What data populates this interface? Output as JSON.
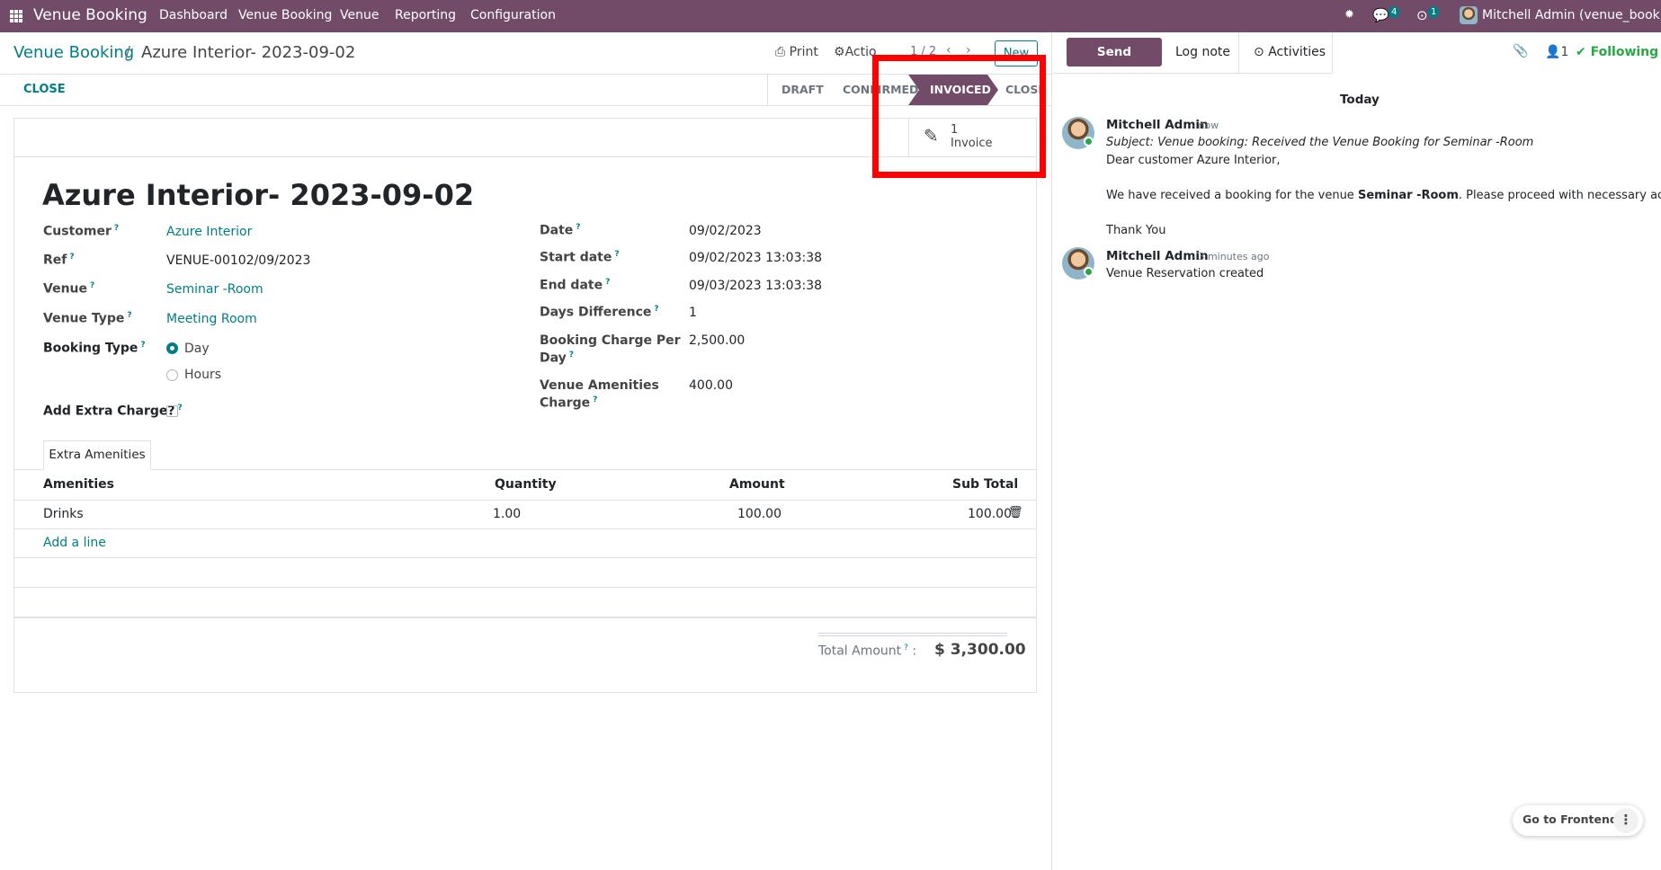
{
  "topbar": {
    "app": "Venue Booking",
    "menu": [
      "Dashboard",
      "Venue Booking",
      "Venue",
      "Reporting",
      "Configuration"
    ],
    "messages": "4",
    "activities": "1",
    "user": "Mitchell Admin (venue_booking)"
  },
  "breadcrumb": {
    "parent": "Venue Booking",
    "sep": "/",
    "current": "Azure Interior- 2023-09-02"
  },
  "cp": {
    "print": "Print",
    "action": "Actio",
    "pager": "1 / 2",
    "new": "New",
    "close": "CLOSE"
  },
  "stages": [
    "DRAFT",
    "CONFIRMED",
    "INVOICED",
    "CLOSE"
  ],
  "smart": {
    "count": "1",
    "label": "Invoice"
  },
  "title": "Azure Interior- 2023-09-02",
  "left": {
    "customer_l": "Customer",
    "customer": "Azure Interior",
    "ref_l": "Ref",
    "ref": "VENUE-00102/09/2023",
    "venue_l": "Venue",
    "venue": "Seminar -Room",
    "type_l": "Venue Type",
    "type": "Meeting Room",
    "booking_l": "Booking Type",
    "day": "Day",
    "hours": "Hours",
    "extra_l": "Add Extra Charge?"
  },
  "right": {
    "date_l": "Date",
    "date": "09/02/2023",
    "start_l": "Start date",
    "start": "09/02/2023 13:03:38",
    "end_l": "End date",
    "end": "09/03/2023 13:03:38",
    "diff_l": "Days Difference",
    "diff": "1",
    "charge_l1": "Booking Charge Per",
    "charge_l2": "Day",
    "charge": "2,500.00",
    "amen_l1": "Venue Amenities",
    "amen_l2": "Charge",
    "amen": "400.00"
  },
  "tab": "Extra Amenities",
  "table": {
    "headers": [
      "Amenities",
      "Quantity",
      "Amount",
      "Sub Total"
    ],
    "rows": [
      [
        "Drinks",
        "1.00",
        "100.00",
        "100.00"
      ]
    ],
    "add": "Add a line"
  },
  "total": {
    "label": "Total Amount",
    "value": "$ 3,300.00"
  },
  "chatter": {
    "send": "Send message",
    "log": "Log note",
    "activities": "Activities",
    "att": "1",
    "following": "Following",
    "today": "Today",
    "m1": {
      "author": "Mitchell Admin",
      "time": "- now",
      "subject": "Subject: Venue booking: Received the Venue Booking for Seminar -Room",
      "l1": "Dear customer Azure Interior,",
      "l2a": "We have received a booking for the venue ",
      "l2b": "Seminar -Room",
      "l2c": ". Please proceed with necessary actions.",
      "l3": "Thank You"
    },
    "m2": {
      "author": "Mitchell Admin",
      "time": "- 3 minutes ago",
      "body": "Venue Reservation created"
    }
  },
  "frontend": "Go to Frontend",
  "colors": {
    "brand": "#714b67",
    "link": "#017e84",
    "highlight": "#ff0000"
  }
}
